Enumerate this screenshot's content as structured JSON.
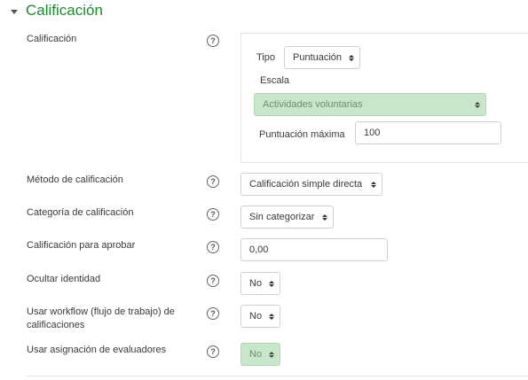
{
  "section": {
    "title": "Calificación"
  },
  "grade": {
    "label": "Calificación",
    "type_label": "Tipo",
    "type_value": "Puntuación",
    "scale_label": "Escala",
    "scale_value": "Actividades voluntarias",
    "max_grade_label": "Puntuación máxima",
    "max_grade_value": "100"
  },
  "grading_method": {
    "label": "Método de calificación",
    "value": "Calificación simple directa"
  },
  "grade_category": {
    "label": "Categoría de calificación",
    "value": "Sin categorizar"
  },
  "grade_to_pass": {
    "label": "Calificación para aprobar",
    "value": "0,00"
  },
  "hide_identity": {
    "label": "Ocultar identidad",
    "value": "No"
  },
  "marking_workflow": {
    "label": "Usar workflow (flujo de trabajo) de calificaciones",
    "value": "No"
  },
  "marker_allocation": {
    "label": "Usar asignación de evaluadores",
    "value": "No"
  },
  "help_icon_glyph": "?",
  "colors": {
    "section_title": "#1d8a2e",
    "disabled_bg": "#c8e6c9"
  }
}
